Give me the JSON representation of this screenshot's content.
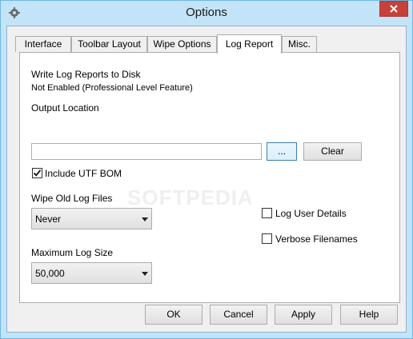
{
  "window": {
    "title": "Options"
  },
  "tabs": [
    {
      "label": "Interface",
      "active": false
    },
    {
      "label": "Toolbar Layout",
      "active": false
    },
    {
      "label": "Wipe Options",
      "active": false
    },
    {
      "label": "Log Report",
      "active": true
    },
    {
      "label": "Misc.",
      "active": false
    }
  ],
  "log_report": {
    "write_heading": "Write Log Reports to Disk",
    "write_status": "Not Enabled (Professional Level Feature)",
    "output_location_label": "Output Location",
    "output_location_value": "",
    "browse_label": "...",
    "clear_label": "Clear",
    "include_bom_label": "Include UTF BOM",
    "include_bom_checked": true,
    "wipe_old_label": "Wipe Old Log Files",
    "wipe_old_value": "Never",
    "max_size_label": "Maximum Log Size",
    "max_size_value": "50,000",
    "log_user_details_label": "Log User Details",
    "log_user_details_checked": false,
    "verbose_filenames_label": "Verbose Filenames",
    "verbose_filenames_checked": false
  },
  "watermark": "SOFTPEDIA",
  "footer": {
    "ok_label": "OK",
    "cancel_label": "Cancel",
    "apply_label": "Apply",
    "help_label": "Help"
  },
  "colors": {
    "frame": "#c3e4f8",
    "close_button": "#c7413a",
    "panel": "#ffffff",
    "dialog": "#f0f0f0"
  }
}
